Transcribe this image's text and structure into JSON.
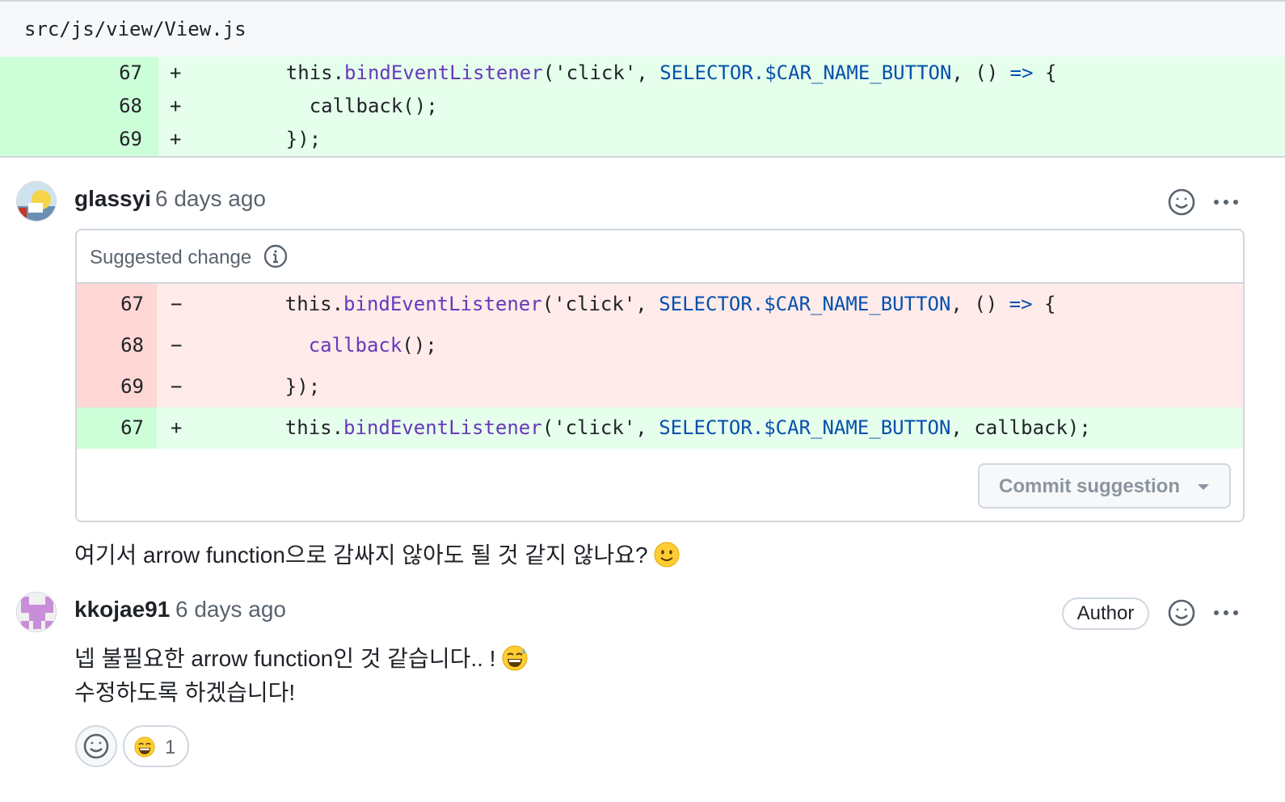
{
  "file": {
    "path": "src/js/view/View.js"
  },
  "diff_lines": [
    {
      "num": "67",
      "sign": "+",
      "indent": "    ",
      "parts": [
        "this.",
        "bindEventListener",
        "('click', ",
        "SELECTOR.$CAR_NAME_BUTTON",
        ", () ",
        "=>",
        " {"
      ]
    },
    {
      "num": "68",
      "sign": "+",
      "indent": "      ",
      "text": "callback();"
    },
    {
      "num": "69",
      "sign": "+",
      "indent": "    ",
      "text": "});"
    }
  ],
  "comment1": {
    "author": "glassyi",
    "time": "6 days ago",
    "suggestion_title": "Suggested change",
    "suggestion_lines": [
      {
        "num": "67",
        "sign": "−",
        "indent": "    ",
        "parts": [
          "this.",
          "bindEventListener",
          "('click', ",
          "SELECTOR.$CAR_NAME_BUTTON",
          ", () ",
          "=>",
          " {"
        ]
      },
      {
        "num": "68",
        "sign": "−",
        "indent": "      ",
        "parts": [
          "callback",
          "();"
        ]
      },
      {
        "num": "69",
        "sign": "−",
        "indent": "    ",
        "text": "});"
      },
      {
        "num": "67",
        "sign": "+",
        "indent": "    ",
        "parts": [
          "this.",
          "bindEventListener",
          "('click', ",
          "SELECTOR.$CAR_NAME_BUTTON",
          ", callback);"
        ]
      }
    ],
    "commit_label": "Commit suggestion",
    "body": "여기서 arrow function으로 감싸지 않아도 될 것 같지 않나요?"
  },
  "comment2": {
    "author": "kkojae91",
    "time": "6 days ago",
    "badge": "Author",
    "body_line1": "넵 불필요한 arrow function인 것 같습니다.. !",
    "body_line2": "수정하도록 하겠습니다!",
    "reaction_count": "1"
  },
  "icons": {
    "reaction": "smiley-icon",
    "more": "kebab-horizontal-icon",
    "info": "info-icon",
    "caret": "triangle-down-icon"
  },
  "colors": {
    "add_bg": "#e6ffec",
    "add_num_bg": "#ccffd8",
    "del_bg": "#ffebe9",
    "del_num_bg": "#ffd7d5",
    "function": "#6639ba",
    "constant": "#0550ae"
  }
}
